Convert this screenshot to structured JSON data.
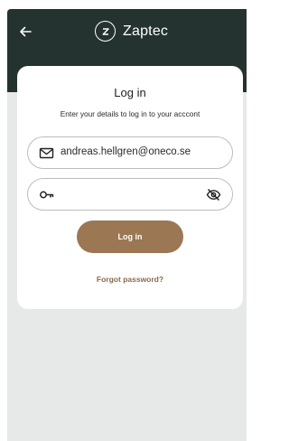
{
  "header": {
    "brand_name": "Zaptec",
    "logo_letter": "Z",
    "back_icon": "arrow-left-icon"
  },
  "login": {
    "title": "Log in",
    "subtitle": "Enter your details to log in to your acccont",
    "email_value": "andreas.hellgren@oneco.se",
    "email_icon": "mail-icon",
    "password_value": "",
    "password_icon": "key-icon",
    "visibility_icon": "eye-off-icon",
    "button_label": "Log in",
    "forgot_label": "Forgot password?"
  },
  "colors": {
    "header_bg": "#253330",
    "button_bg": "#9b7754",
    "link": "#8a6a4c",
    "page_bg": "#e7e9e9"
  }
}
